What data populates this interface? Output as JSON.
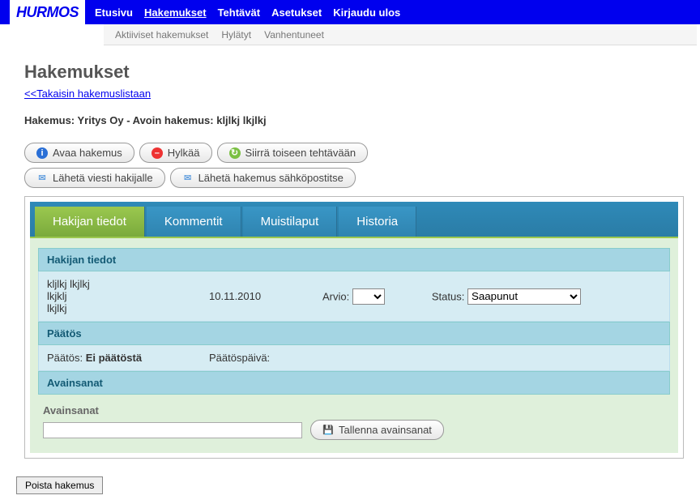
{
  "logo": "HURMOS",
  "topnav": [
    "Etusivu",
    "Hakemukset",
    "Tehtävät",
    "Asetukset",
    "Kirjaudu ulos"
  ],
  "topnav_active": 1,
  "subnav": [
    "Aktiiviset hakemukset",
    "Hylätyt",
    "Vanhentuneet"
  ],
  "page_title": "Hakemukset",
  "back_link": "<<Takaisin hakemuslistaan",
  "meta": "Hakemus: Yritys Oy - Avoin hakemus: kljlkj lkjlkj",
  "buttons": {
    "open": "Avaa hakemus",
    "reject": "Hylkää",
    "move": "Siirrä toiseen tehtävään",
    "msg": "Lähetä viesti hakijalle",
    "email": "Lähetä hakemus sähköpostitse",
    "save_kw": "Tallenna avainsanat",
    "delete": "Poista hakemus"
  },
  "tabs": [
    "Hakijan tiedot",
    "Kommentit",
    "Muistilaput",
    "Historia"
  ],
  "sections": {
    "applicant": {
      "heading": "Hakijan tiedot",
      "name": "kljlkj lkjlkj",
      "line2": "lkjklj",
      "line3": "lkjlkj",
      "date": "10.11.2010",
      "rating_label": "Arvio:",
      "rating_value": "",
      "status_label": "Status:",
      "status_value": "Saapunut"
    },
    "decision": {
      "heading": "Päätös",
      "decision_label": "Päätös:",
      "decision_value": "Ei päätöstä",
      "decision_date_label": "Päätöspäivä:",
      "decision_date_value": ""
    },
    "keywords": {
      "heading": "Avainsanat",
      "sub": "Avainsanat",
      "value": ""
    }
  }
}
